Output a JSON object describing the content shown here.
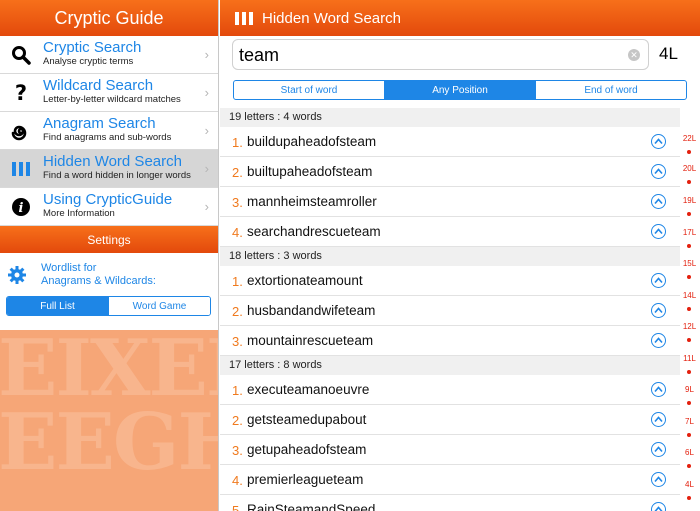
{
  "sidebar": {
    "title": "Cryptic Guide",
    "items": [
      {
        "title": "Cryptic Search",
        "subtitle": "Analyse cryptic terms",
        "icon": "search-icon"
      },
      {
        "title": "Wildcard Search",
        "subtitle": "Letter-by-letter wildcard matches",
        "icon": "question-icon"
      },
      {
        "title": "Anagram Search",
        "subtitle": "Find anagrams and sub-words",
        "icon": "spiral-icon"
      },
      {
        "title": "Hidden Word Search",
        "subtitle": "Find a word hidden in longer words",
        "icon": "book-icon"
      },
      {
        "title": "Using CrypticGuide",
        "subtitle": "More Information",
        "icon": "info-icon"
      }
    ],
    "selected_index": 3,
    "settings_label": "Settings",
    "wordlist_label_line1": "Wordlist for",
    "wordlist_label_line2": "Anagrams & Wildcards:",
    "wordlist_options": [
      "Full List",
      "Word Game"
    ],
    "wordlist_selected": "Full List",
    "background_art_text": [
      "EIXEE",
      "EEGH"
    ]
  },
  "main": {
    "title": "Hidden Word Search",
    "search_value": "team",
    "letter_count": "4L",
    "position_options": [
      "Start of word",
      "Any Position",
      "End of word"
    ],
    "position_selected": "Any Position",
    "groups": [
      {
        "header": "19 letters : 4 words",
        "words": [
          {
            "num": "1.",
            "word": "buildupaheadofsteam"
          },
          {
            "num": "2.",
            "word": "builtupaheadofsteam"
          },
          {
            "num": "3.",
            "word": "mannheimsteamroller"
          },
          {
            "num": "4.",
            "word": "searchandrescueteam"
          }
        ]
      },
      {
        "header": "18 letters : 3 words",
        "words": [
          {
            "num": "1.",
            "word": "extortionateamount"
          },
          {
            "num": "2.",
            "word": "husbandandwifeteam"
          },
          {
            "num": "3.",
            "word": "mountainrescueteam"
          }
        ]
      },
      {
        "header": "17 letters : 8 words",
        "words": [
          {
            "num": "1.",
            "word": "executeamanoeuvre"
          },
          {
            "num": "2.",
            "word": "getsteamedupabout"
          },
          {
            "num": "3.",
            "word": "getupaheadofsteam"
          },
          {
            "num": "4.",
            "word": "premierleagueteam"
          },
          {
            "num": "5.",
            "word": "RainSteamandSpeed"
          }
        ]
      }
    ],
    "index_labels": [
      "22L",
      "20L",
      "19L",
      "17L",
      "15L",
      "14L",
      "12L",
      "11L",
      "9L",
      "7L",
      "6L",
      "4L"
    ]
  },
  "colors": {
    "accent_orange": "#f07a1e",
    "header_orange": "#e3490c",
    "link_blue": "#1e86e6",
    "index_red": "#e3200e"
  }
}
